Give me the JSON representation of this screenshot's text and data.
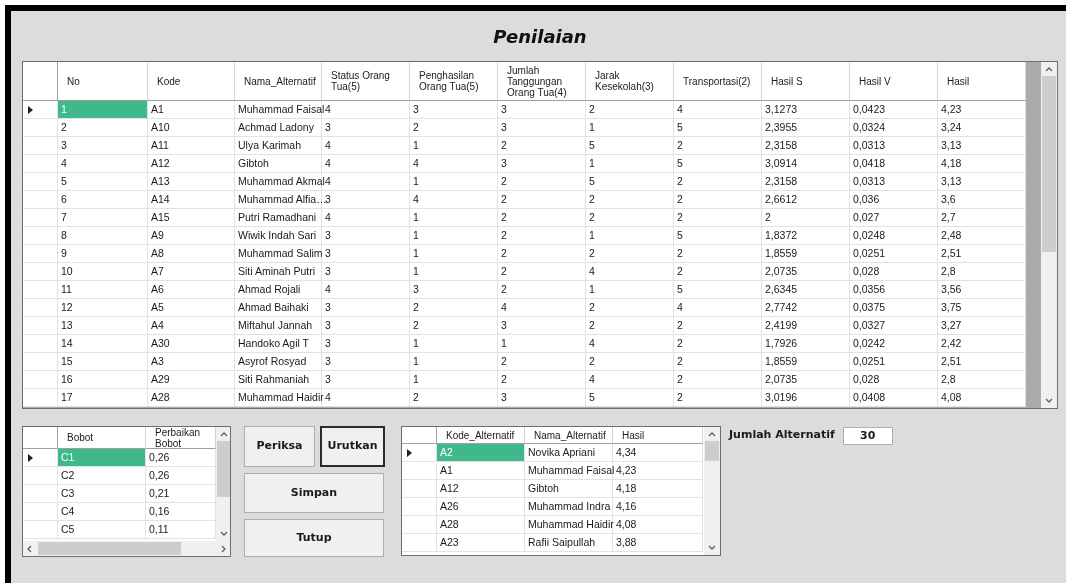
{
  "title": "Penilaian",
  "main_table": {
    "columns": [
      "No",
      "Kode",
      "Nama_Alternatif",
      "Status Orang Tua(5)",
      "Penghasilan Orang Tua(5)",
      "Jumlah Tanggungan Orang Tua(4)",
      "Jarak Kesekolah(3)",
      "Transportasi(2)",
      "Hasil S",
      "Hasil V",
      "Hasil"
    ],
    "rows": [
      {
        "selected": true,
        "cells": [
          "1",
          "A1",
          "Muhammad Faisal",
          "4",
          "3",
          "3",
          "2",
          "4",
          "3,1273",
          "0,0423",
          "4,23"
        ]
      },
      {
        "selected": false,
        "cells": [
          "2",
          "A10",
          "Achmad Ladony",
          "3",
          "2",
          "3",
          "1",
          "5",
          "2,3955",
          "0,0324",
          "3,24"
        ]
      },
      {
        "selected": false,
        "cells": [
          "3",
          "A11",
          "Ulya Karimah",
          "4",
          "1",
          "2",
          "5",
          "2",
          "2,3158",
          "0,0313",
          "3,13"
        ]
      },
      {
        "selected": false,
        "cells": [
          "4",
          "A12",
          "Gibtoh",
          "4",
          "4",
          "3",
          "1",
          "5",
          "3,0914",
          "0,0418",
          "4,18"
        ]
      },
      {
        "selected": false,
        "cells": [
          "5",
          "A13",
          "Muhammad Akmal",
          "4",
          "1",
          "2",
          "5",
          "2",
          "2,3158",
          "0,0313",
          "3,13"
        ]
      },
      {
        "selected": false,
        "cells": [
          "6",
          "A14",
          "Muhammad Alfia…",
          "3",
          "4",
          "2",
          "2",
          "2",
          "2,6612",
          "0,036",
          "3,6"
        ]
      },
      {
        "selected": false,
        "cells": [
          "7",
          "A15",
          "Putri Ramadhani",
          "4",
          "1",
          "2",
          "2",
          "2",
          "2",
          "0,027",
          "2,7"
        ]
      },
      {
        "selected": false,
        "cells": [
          "8",
          "A9",
          "Wiwik Indah Sari",
          "3",
          "1",
          "2",
          "1",
          "5",
          "1,8372",
          "0,0248",
          "2,48"
        ]
      },
      {
        "selected": false,
        "cells": [
          "9",
          "A8",
          "Muhammad Salim",
          "3",
          "1",
          "2",
          "2",
          "2",
          "1,8559",
          "0,0251",
          "2,51"
        ]
      },
      {
        "selected": false,
        "cells": [
          "10",
          "A7",
          "Siti Aminah Putri",
          "3",
          "1",
          "2",
          "4",
          "2",
          "2,0735",
          "0,028",
          "2,8"
        ]
      },
      {
        "selected": false,
        "cells": [
          "11",
          "A6",
          "Ahmad Rojali",
          "4",
          "3",
          "2",
          "1",
          "5",
          "2,6345",
          "0,0356",
          "3,56"
        ]
      },
      {
        "selected": false,
        "cells": [
          "12",
          "A5",
          "Ahmad Baihaki",
          "3",
          "2",
          "4",
          "2",
          "4",
          "2,7742",
          "0,0375",
          "3,75"
        ]
      },
      {
        "selected": false,
        "cells": [
          "13",
          "A4",
          "Miftahul Jannah",
          "3",
          "2",
          "3",
          "2",
          "2",
          "2,4199",
          "0,0327",
          "3,27"
        ]
      },
      {
        "selected": false,
        "cells": [
          "14",
          "A30",
          "Handoko Agil T",
          "3",
          "1",
          "1",
          "4",
          "2",
          "1,7926",
          "0,0242",
          "2,42"
        ]
      },
      {
        "selected": false,
        "cells": [
          "15",
          "A3",
          "Asyrof Rosyad",
          "3",
          "1",
          "2",
          "2",
          "2",
          "1,8559",
          "0,0251",
          "2,51"
        ]
      },
      {
        "selected": false,
        "cells": [
          "16",
          "A29",
          "Siti Rahmaniah",
          "3",
          "1",
          "2",
          "4",
          "2",
          "2,0735",
          "0,028",
          "2,8"
        ]
      },
      {
        "selected": false,
        "cells": [
          "17",
          "A28",
          "Muhammad Haidir",
          "4",
          "2",
          "3",
          "5",
          "2",
          "3,0196",
          "0,0408",
          "4,08"
        ]
      }
    ]
  },
  "weights_table": {
    "columns": [
      "Bobot",
      "Perbaikan Bobot"
    ],
    "rows": [
      {
        "selected": true,
        "cells": [
          "C1",
          "0,26"
        ]
      },
      {
        "selected": false,
        "cells": [
          "C2",
          "0,26"
        ]
      },
      {
        "selected": false,
        "cells": [
          "C3",
          "0,21"
        ]
      },
      {
        "selected": false,
        "cells": [
          "C4",
          "0,16"
        ]
      },
      {
        "selected": false,
        "cells": [
          "C5",
          "0,11"
        ]
      }
    ]
  },
  "buttons": [
    {
      "label": "Periksa",
      "focused": false
    },
    {
      "label": "Urutkan",
      "focused": true
    },
    {
      "label": "Simpan",
      "focused": false
    },
    {
      "label": "Tutup",
      "focused": false
    }
  ],
  "ranking_table": {
    "columns": [
      "Kode_Alternatif",
      "Nama_Alternatif",
      "Hasil"
    ],
    "rows": [
      {
        "selected": true,
        "cells": [
          "A2",
          "Novika Apriani",
          "4,34"
        ]
      },
      {
        "selected": false,
        "cells": [
          "A1",
          "Muhammad Faisal",
          "4,23"
        ]
      },
      {
        "selected": false,
        "cells": [
          "A12",
          "Gibtoh",
          "4,18"
        ]
      },
      {
        "selected": false,
        "cells": [
          "A26",
          "Muhammad Indra",
          "4,16"
        ]
      },
      {
        "selected": false,
        "cells": [
          "A28",
          "Muhammad Haidir",
          "4,08"
        ]
      },
      {
        "selected": false,
        "cells": [
          "A23",
          "Rafii Saipullah",
          "3,88"
        ]
      }
    ]
  },
  "total": {
    "label": "Jumlah Alternatif",
    "value": "30"
  }
}
